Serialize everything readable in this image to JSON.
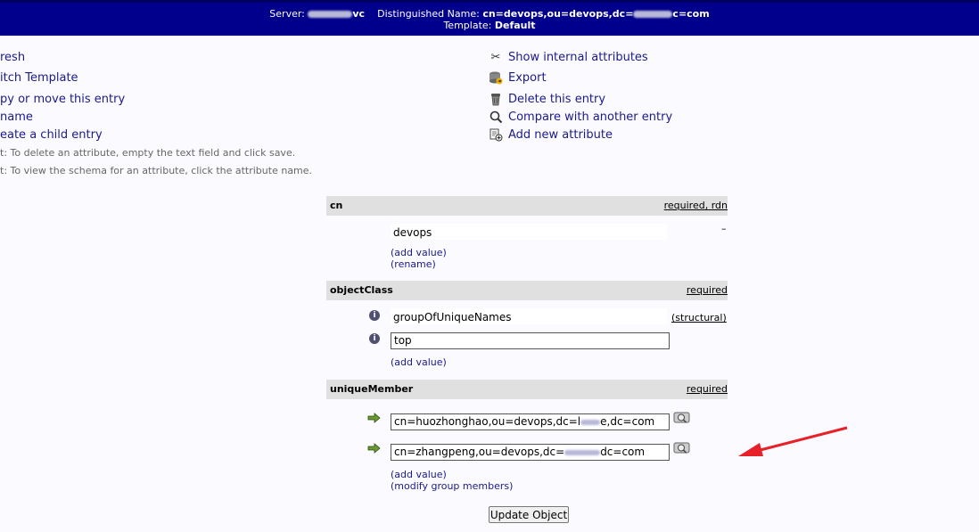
{
  "header": {
    "server_label": "Server:",
    "server_suffix": "vc",
    "dn_label": "Distinguished Name:",
    "dn_prefix": "cn=devops,ou=devops,dc=",
    "dn_suffix": "c=com",
    "template_label": "Template:",
    "template_value": "Default"
  },
  "left_actions": {
    "refresh": "resh",
    "switch_template": "itch Template",
    "copy_move": "py or move this entry",
    "rename": "name",
    "create_child": "eate a child entry"
  },
  "hints": {
    "delete_hint": "t: To delete an attribute, empty the text field and click save.",
    "schema_hint": "t: To view the schema for an attribute, click the attribute name."
  },
  "right_actions": {
    "show_internal": "Show internal attributes",
    "export": "Export",
    "delete_entry": "Delete this entry",
    "compare": "Compare with another entry",
    "add_attribute": "Add new attribute"
  },
  "attributes": {
    "cn": {
      "name": "cn",
      "required": "required",
      "comma": ",",
      "rdn": "rdn",
      "value": "devops",
      "add_value": "(add value)",
      "rename": "(rename)"
    },
    "objectClass": {
      "name": "objectClass",
      "required": "required",
      "value1": "groupOfUniqueNames",
      "structural": "(structural)",
      "value2": "top",
      "add_value": "(add value)"
    },
    "uniqueMember": {
      "name": "uniqueMember",
      "required": "required",
      "value1_prefix": "cn=huozhonghao,ou=devops,dc=l",
      "value1_suffix": "e,dc=com",
      "value2_prefix": "cn=zhangpeng,ou=devops,dc=",
      "value2_suffix": "dc=com",
      "add_value": "(add value)",
      "modify_members": "(modify group members)"
    }
  },
  "buttons": {
    "update": "Update Object"
  },
  "colors": {
    "header_bg": "#00008c",
    "link": "#1a1a8c",
    "attr_header_bg": "#e0e0e0",
    "annotation_arrow": "#e8202a"
  },
  "icons": {
    "show_internal": "scissors-icon",
    "export": "export-icon",
    "delete_entry": "trash-icon",
    "compare": "magnify-icon",
    "add_attribute": "add-attribute-icon",
    "info": "info-icon",
    "member_arrow": "green-arrow-icon",
    "lookup": "lookup-icon"
  }
}
